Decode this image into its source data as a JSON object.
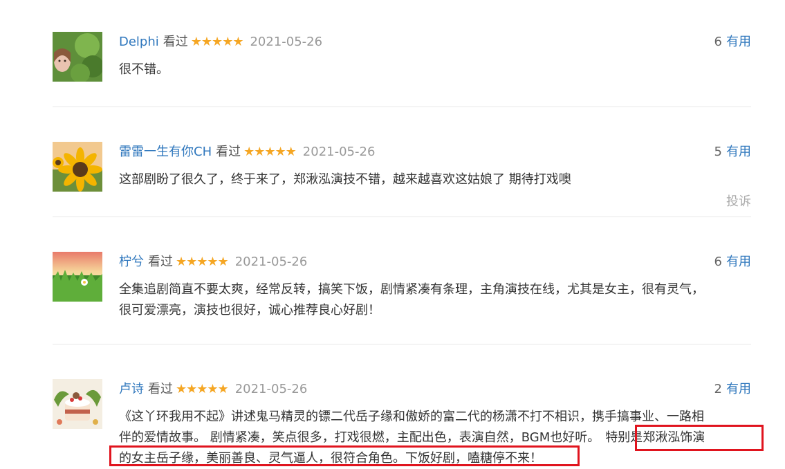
{
  "reviews": [
    {
      "author": "Delphi",
      "watched": "看过",
      "stars": "★★★★★",
      "date": "2021-05-26",
      "useful_count": "6",
      "useful_label": "有用",
      "text": "很不错。"
    },
    {
      "author": "雷雷一生有你CH",
      "watched": "看过",
      "stars": "★★★★★",
      "date": "2021-05-26",
      "useful_count": "5",
      "useful_label": "有用",
      "text": "这部剧盼了很久了，终于来了，郑湫泓演技不错，越来越喜欢这姑娘了 期待打戏噢",
      "report": "投诉"
    },
    {
      "author": "柠兮",
      "watched": "看过",
      "stars": "★★★★★",
      "date": "2021-05-26",
      "useful_count": "6",
      "useful_label": "有用",
      "text_line1": "全集追剧简直不要太爽，经常反转，搞笑下饭，剧情紧凑有条理，主角演技在线，尤其是女主，很有灵气，",
      "text_line2": "很可爱漂亮，演技也很好，诚心推荐良心好剧！"
    },
    {
      "author": "卢诗",
      "watched": "看过",
      "stars": "★★★★★",
      "date": "2021-05-26",
      "useful_count": "2",
      "useful_label": "有用",
      "text_line1": "《这丫环我用不起》讲述鬼马精灵的镖二代岳子缘和傲娇的富二代的杨潇不打不相识，携手搞事业、一路相",
      "text_line2_a": "伴的爱情故事。 剧情紧凑，笑点很多，打戏很燃，主配出色，表演自然，BGM也好听。",
      "text_line2_b": "特别是郑湫泓饰演",
      "text_line3": "的女主岳子缘，美丽善良、灵气逼人，很符合角色。下饭好剧，嗑糖停不来！"
    }
  ]
}
